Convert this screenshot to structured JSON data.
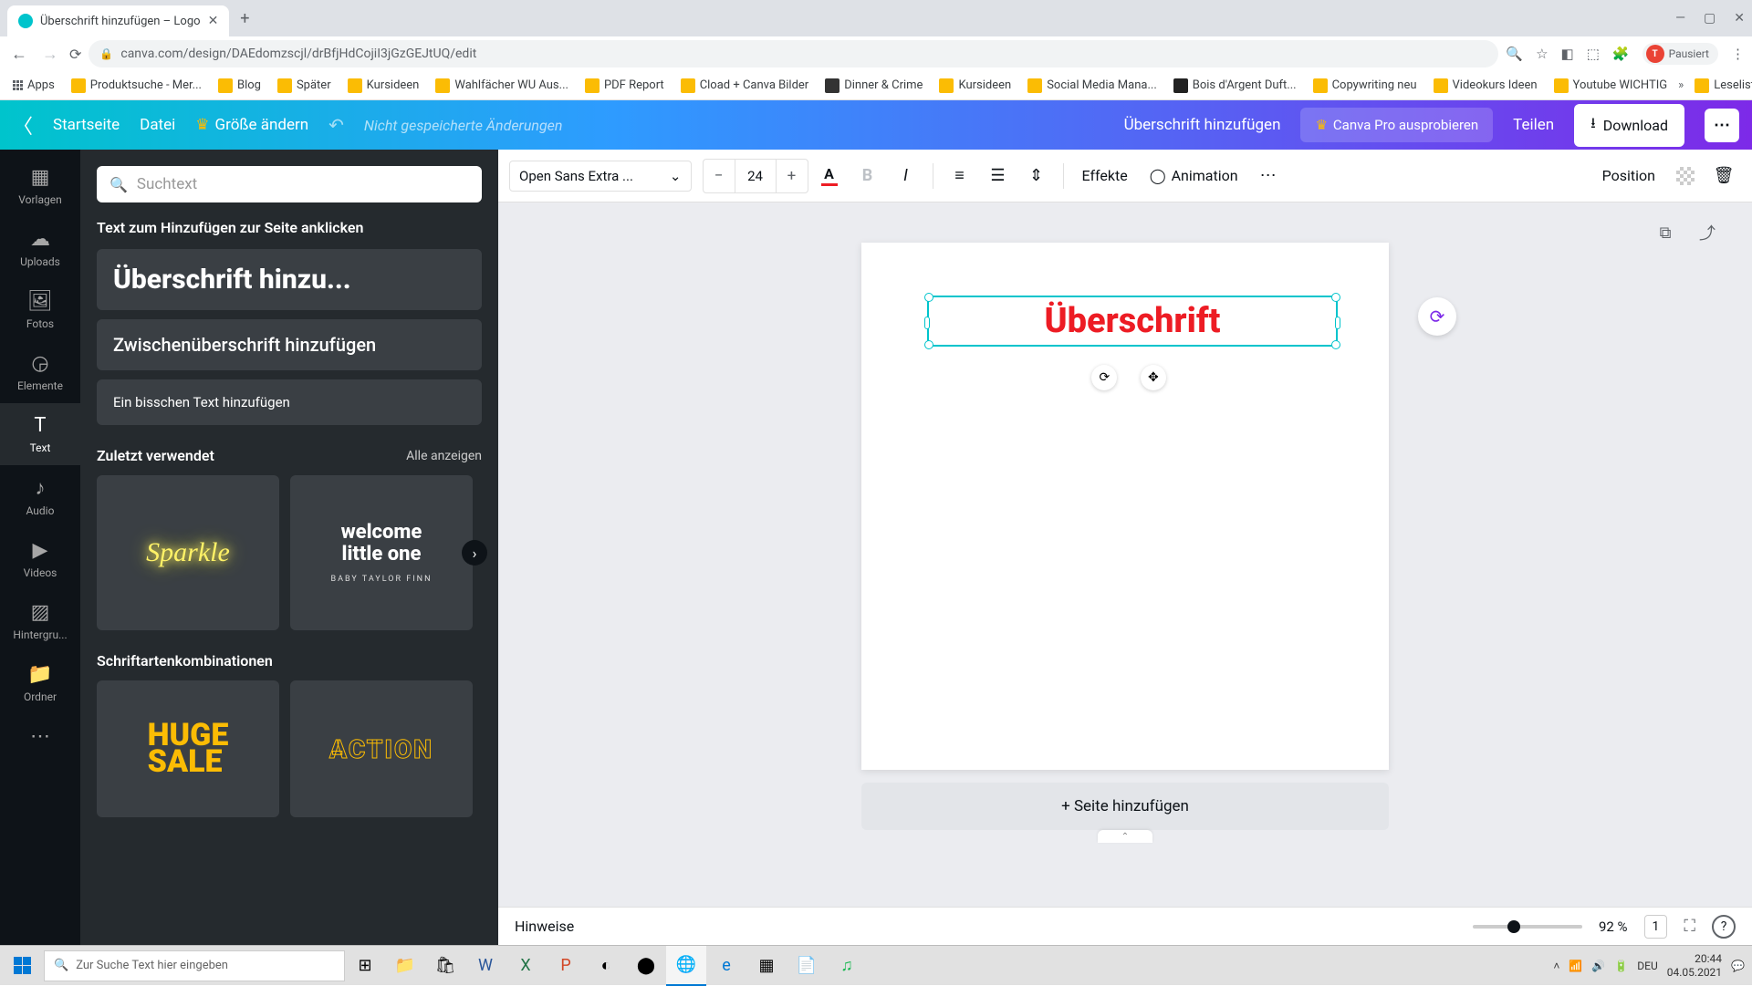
{
  "browser": {
    "tab_title": "Überschrift hinzufügen – Logo",
    "url": "canva.com/design/DAEdomzscjl/drBfjHdCojiI3jGzGEJtUQ/edit",
    "profile_status": "Pausiert",
    "bookmarks": [
      "Apps",
      "Produktsuche - Mer...",
      "Blog",
      "Später",
      "Kursideen",
      "Wahlfächer WU Aus...",
      "PDF Report",
      "Cload + Canva Bilder",
      "Dinner & Crime",
      "Kursideen",
      "Social Media Mana...",
      "Bois d'Argent Duft...",
      "Copywriting neu",
      "Videokurs Ideen",
      "Youtube WICHTIG",
      "Leseliste"
    ]
  },
  "header": {
    "home": "Startseite",
    "file": "Datei",
    "resize": "Größe ändern",
    "save_status": "Nicht gespeicherte Änderungen",
    "doc_title": "Überschrift hinzufügen",
    "pro": "Canva Pro ausprobieren",
    "share": "Teilen",
    "download": "Download"
  },
  "rail": {
    "templates": "Vorlagen",
    "uploads": "Uploads",
    "photos": "Fotos",
    "elements": "Elemente",
    "text": "Text",
    "audio": "Audio",
    "videos": "Videos",
    "background": "Hintergru...",
    "folders": "Ordner"
  },
  "panel": {
    "search_placeholder": "Suchtext",
    "click_to_add": "Text zum Hinzufügen zur Seite anklicken",
    "add_heading": "Überschrift hinzu...",
    "add_subheading": "Zwischenüberschrift hinzufügen",
    "add_body": "Ein bisschen Text hinzufügen",
    "recently_used": "Zuletzt verwendet",
    "see_all": "Alle anzeigen",
    "font_combos": "Schriftartenkombinationen",
    "sparkle": "Sparkle",
    "welcome_line1": "welcome",
    "welcome_line2": "little one",
    "welcome_sub": "BABY TAYLOR FINN",
    "huge": "HUGE",
    "sale": "SALE",
    "action": "ACTION"
  },
  "toolbar": {
    "font": "Open Sans Extra ...",
    "size": "24",
    "effects": "Effekte",
    "animation": "Animation",
    "position": "Position"
  },
  "canvas": {
    "text_content": "Überschrift",
    "add_page": "+ Seite hinzufügen"
  },
  "bottom": {
    "notes": "Hinweise",
    "zoom": "92 %",
    "page_count": "1"
  },
  "taskbar": {
    "search_placeholder": "Zur Suche Text hier eingeben",
    "lang": "DEU",
    "time": "20:44",
    "date": "04.05.2021"
  }
}
